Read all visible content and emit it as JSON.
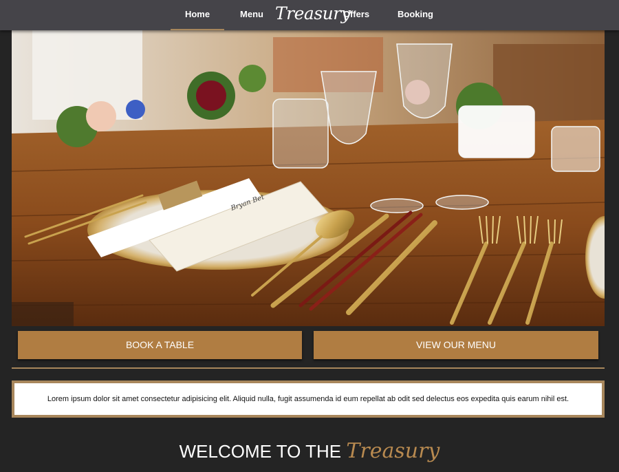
{
  "nav": {
    "items": [
      {
        "label": "Home",
        "active": true
      },
      {
        "label": "Menu",
        "active": false
      },
      {
        "label": "Offers",
        "active": false
      },
      {
        "label": "Booking",
        "active": false
      }
    ],
    "logo": "Treasury",
    "active_color": "#a8875c"
  },
  "hero": {
    "image": "place-setting-on-rustic-wooden-table",
    "place_card_text": "Bryan Bet"
  },
  "actions": {
    "book_label": "BOOK A TABLE",
    "menu_label": "VIEW OUR MENU"
  },
  "info": {
    "text": "Lorem ipsum dolor sit amet consectetur adipisicing elit. Aliquid nulla, fugit assumenda id eum repellat ab odit sed delectus eos expedita quis earum nihil est."
  },
  "welcome": {
    "prefix": "WELCOME TO THE",
    "brand": "Treasury"
  },
  "colors": {
    "nav_bg": "#454449",
    "page_bg": "#242424",
    "accent": "#a8875c",
    "button_bg": "#b07d42"
  }
}
